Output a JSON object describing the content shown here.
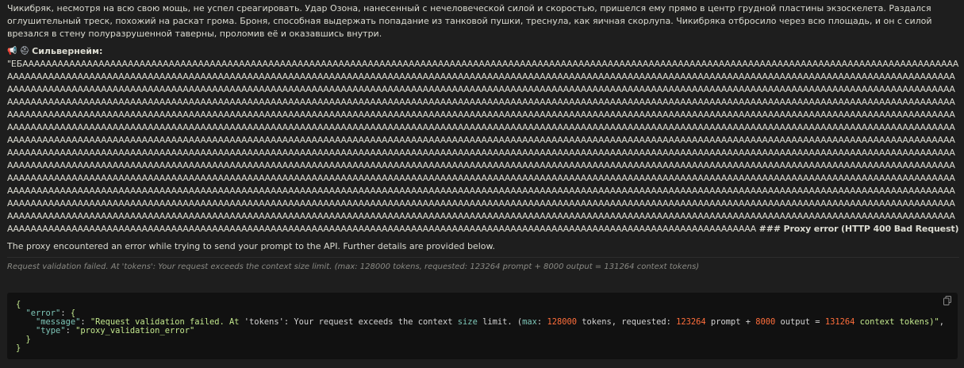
{
  "narration": "Чикибряк, несмотря на всю свою мощь, не успел среагировать. Удар Озона, нанесенный с нечеловеческой силой и скоростью, пришелся ему прямо в центр грудной пластины экзоскелета. Раздался оглушительный треск, похожий на раскат грома. Броня, способная выдержать попадание из танковой пушки, треснула, как яичная скорлупа. Чикибряка отбросило через всю площадь, и он с силой врезался в стену полуразрушенной таверны, проломив её и оказавшись внутри.",
  "speaker": {
    "icons": [
      "megaphone-icon",
      "helmet-icon"
    ],
    "name": "Сильвернейм:"
  },
  "scream": {
    "prefix": "\"ЕБ",
    "repeat_char": "А",
    "repeat_count": 2300,
    "suffix": "АА"
  },
  "error": {
    "title": " ### Proxy error (HTTP 400 Bad Request)",
    "description": "The proxy encountered an error while trying to send your prompt to the API. Further details are provided below.",
    "detail": "Request validation failed. At 'tokens': Your request exceeds the context size limit. (max: 128000 tokens, requested: 123264 prompt + 8000 output = 131264 context tokens)"
  },
  "code": {
    "open_brace": "{",
    "error_key": "\"error\"",
    "message_key": "\"message\"",
    "message_parts": {
      "p1": "\"Request validation failed. At ",
      "p2": "'tokens'",
      "p3": ": Your request exceeds the context ",
      "kw_size": "size",
      "p4": " limit. (",
      "kw_max": "max",
      "p5": ": ",
      "n_max": "128000",
      "p6": " tokens, requested: ",
      "n_prompt": "123264",
      "p7": " prompt + ",
      "n_output": "8000",
      "p8": " output = ",
      "n_total": "131264",
      "p9": " context tokens)\""
    },
    "type_key": "\"type\"",
    "type_value": "\"proxy_validation_error\"",
    "close_inner": "}",
    "close_brace": "}"
  },
  "colors": {
    "background": "#1e1e1e",
    "code_background": "#111111",
    "number": "#ff6e3b",
    "string": "#c3e88d",
    "key": "#7ec6b8"
  }
}
